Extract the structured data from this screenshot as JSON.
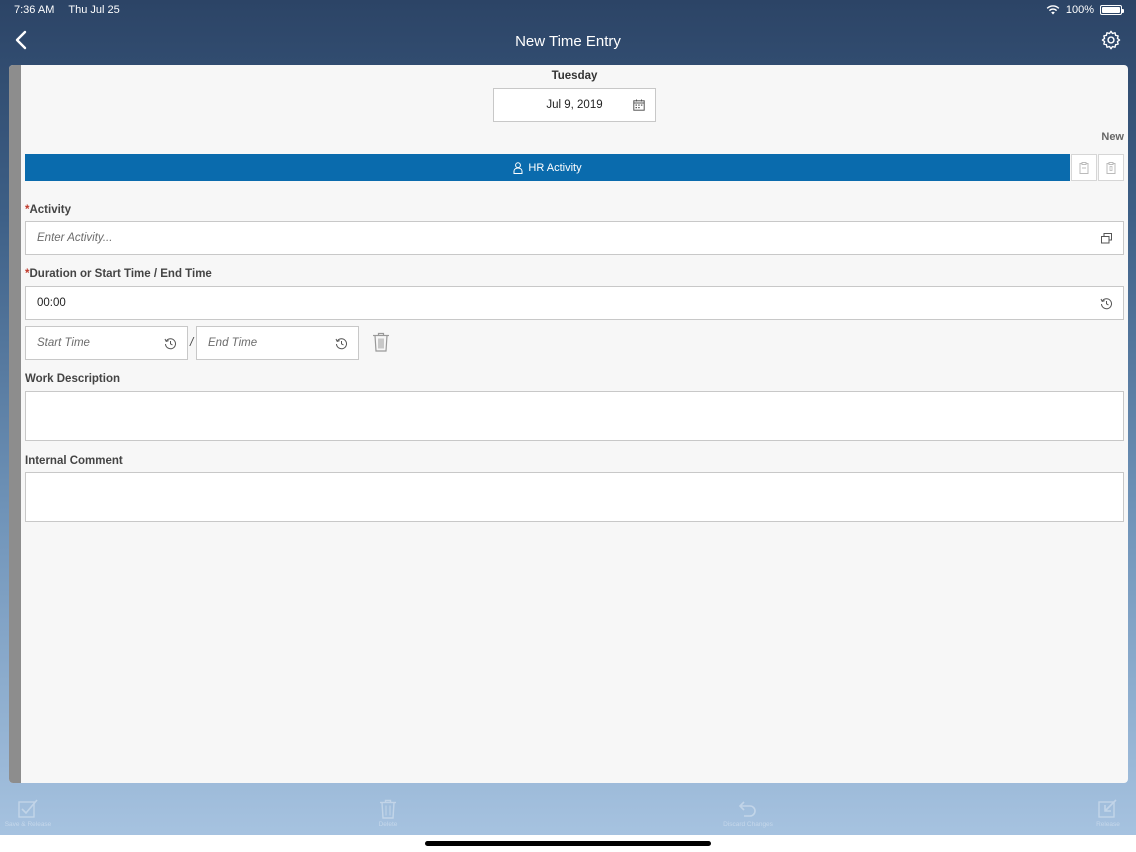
{
  "status_bar": {
    "time": "7:36 AM",
    "date": "Thu Jul 25",
    "battery": "100%",
    "battery_level": 1.0
  },
  "nav": {
    "title": "New Time Entry",
    "back_icon": "chevron-left-icon",
    "settings_icon": "gear-icon"
  },
  "header": {
    "day": "Tuesday",
    "date_value": "Jul 9, 2019",
    "status": "New"
  },
  "tabs": {
    "active_label": "HR Activity",
    "active_color": "#0a6bad"
  },
  "form": {
    "activity_label": "Activity",
    "activity_placeholder": "Enter Activity...",
    "duration_label": "Duration or Start Time / End Time",
    "duration_value": "00:00",
    "start_time_placeholder": "Start Time",
    "separator": "/",
    "end_time_placeholder": "End Time",
    "work_description_label": "Work Description",
    "internal_comment_label": "Internal Comment",
    "required_marker": "*"
  },
  "toolbar": {
    "save_label": "Save & Release",
    "delete_label": "Delete",
    "discard_label": "Discard Changes",
    "release_label": "Release"
  }
}
